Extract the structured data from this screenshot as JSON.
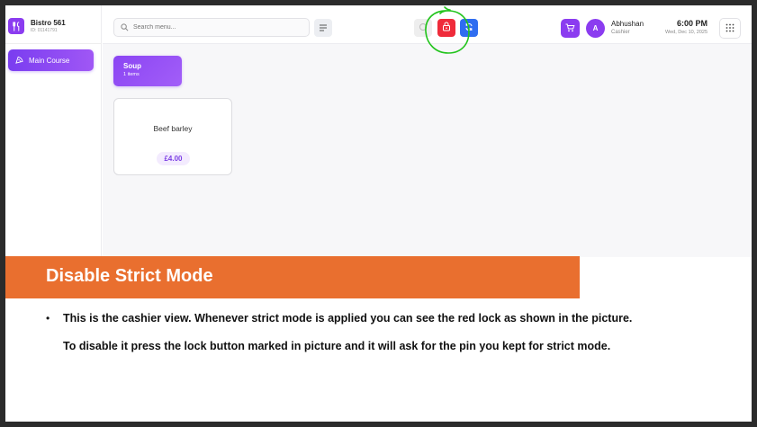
{
  "brand": {
    "name": "Bistro 561",
    "id": "ID: 01141791",
    "logo_icon": "fork-knife-icon"
  },
  "sidebar": {
    "items": [
      {
        "label": "Main Course",
        "icon": "pizza-icon"
      }
    ]
  },
  "search": {
    "placeholder": "Search menu..."
  },
  "user": {
    "initial": "A",
    "name": "Abhushan",
    "role": "Cashier"
  },
  "clock": {
    "time": "6:00 PM",
    "date": "Wed, Dec 10, 2025"
  },
  "categories": [
    {
      "name": "Soup",
      "count": "1 items"
    }
  ],
  "items": [
    {
      "name": "Beef barley",
      "price": "£4.00"
    }
  ],
  "slide": {
    "title": "Disable Strict Mode",
    "bullet": "•",
    "line1": "This is the cashier view. Whenever strict mode is applied you can see the red lock as shown in the picture.",
    "line2": "To disable it press the lock button marked in picture and it will ask for the pin you kept for strict mode."
  },
  "colors": {
    "accent": "#8b3cf0",
    "lock": "#ef2b3a",
    "sync": "#2f6df0",
    "banner": "#e96f2f",
    "annotation": "#22c41c"
  }
}
